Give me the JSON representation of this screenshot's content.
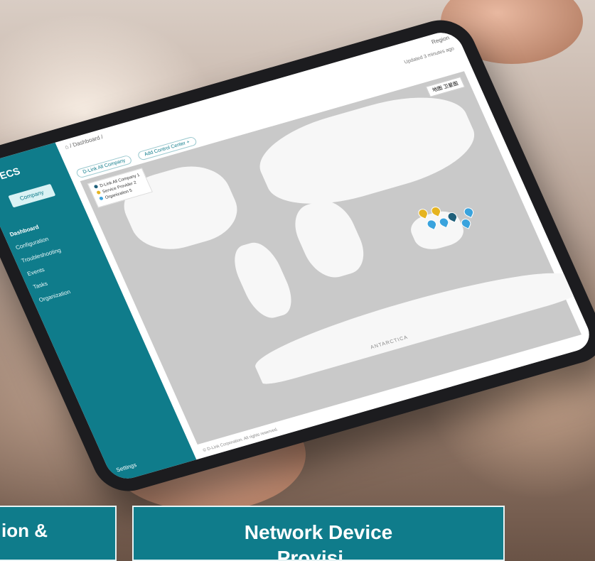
{
  "app": {
    "logo": "D-ECS",
    "company_button": "Company",
    "nav": [
      "Dashboard",
      "Configuration",
      "Troubleshooting",
      "Events",
      "Tasks",
      "Organization"
    ],
    "settings_label": "Settings",
    "breadcrumb": "⌂ / Dashboard /",
    "topright": "Region",
    "updated": "Updated 3 minutes ago",
    "filter_company": "D-Link All Company",
    "filter_center": "Add Control Center +",
    "legend": [
      {
        "label": "D-Link All Company",
        "count": "1",
        "color": "#1f5f7a"
      },
      {
        "label": "Service Provider",
        "count": "2",
        "color": "#e6b420"
      },
      {
        "label": "Organization",
        "count": "5",
        "color": "#3aa3dd"
      }
    ],
    "map_buttons": "地图  卫星图",
    "map_label_ant": "ANTARCTICA",
    "copyright": "© D-Link Corporation. All rights reserved."
  },
  "banners": {
    "left_text": "ion &",
    "right_text": "Network Device",
    "right_sub": "Provisi..."
  },
  "colors": {
    "accent": "#0f7c8b",
    "pin_yellow": "#e6b420",
    "pin_blue": "#3aa3dd",
    "pin_dark": "#1f5f7a"
  }
}
